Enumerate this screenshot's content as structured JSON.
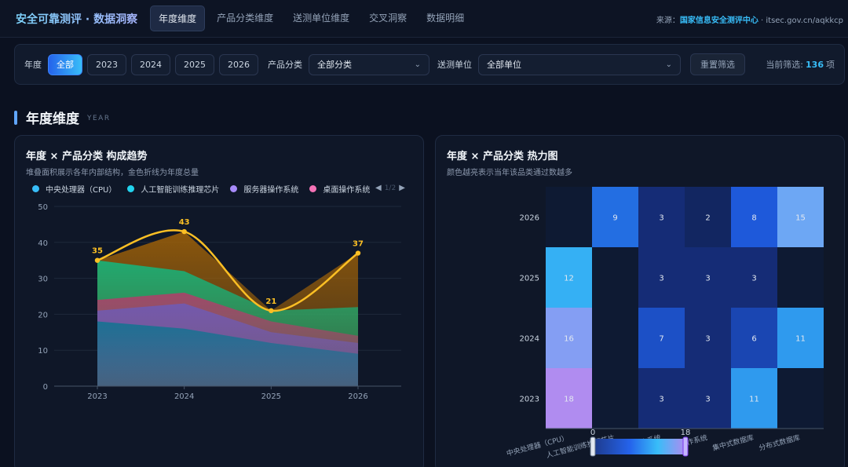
{
  "brand": "安全可靠测评 · 数据洞察",
  "nav": {
    "tabs": [
      "年度维度",
      "产品分类维度",
      "送测单位维度",
      "交叉洞察",
      "数据明细"
    ],
    "active": 0
  },
  "source": {
    "prefix": "来源：",
    "org": "国家信息安全测评中心",
    "suffix": " · itsec.gov.cn/aqkkcp"
  },
  "filters": {
    "year_label": "年度",
    "years": [
      "全部",
      "2023",
      "2024",
      "2025",
      "2026"
    ],
    "active_year": 0,
    "category_label": "产品分类",
    "category_value": "全部分类",
    "unit_label": "送测单位",
    "unit_value": "全部单位",
    "reset_label": "重置筛选",
    "count_prefix": "当前筛选:",
    "count_value": "136",
    "count_suffix": "项"
  },
  "section": {
    "title": "年度维度",
    "subtitle": "YEAR"
  },
  "cards": {
    "left": {
      "title": "年度 × 产品分类 构成趋势",
      "desc": "堆叠面积展示各年内部结构，金色折线为年度总量"
    },
    "right": {
      "title": "年度 × 产品分类 热力图",
      "desc": "颜色越亮表示当年该品类通过数越多"
    }
  },
  "legend": {
    "items": [
      {
        "label": "中央处理器（CPU）",
        "color": "#38bdf8"
      },
      {
        "label": "人工智能训练推理芯片",
        "color": "#22d3ee"
      },
      {
        "label": "服务器操作系统",
        "color": "#a78bfa"
      },
      {
        "label": "桌面操作系统",
        "color": "#f472b6"
      }
    ],
    "page": "1/2"
  },
  "colors": {
    "accent": "#38bdf8",
    "total_line": "#fbbf24"
  },
  "chart_data": [
    {
      "type": "area",
      "title": "年度 × 产品分类 构成趋势",
      "x": [
        "2023",
        "2024",
        "2025",
        "2026"
      ],
      "ylim": [
        0,
        50
      ],
      "yticks": [
        0,
        10,
        20,
        30,
        40,
        50
      ],
      "grid": true,
      "stack_layers": [
        {
          "values": [
            18,
            16,
            12,
            9
          ],
          "color": "#0e7490"
        },
        {
          "values": [
            21,
            23,
            15,
            12
          ],
          "color": "#6d5bb8"
        },
        {
          "values": [
            24,
            26,
            18,
            14
          ],
          "color": "#b43b6a"
        },
        {
          "values": [
            35,
            32,
            21,
            22
          ],
          "color": "#10b981"
        },
        {
          "values": [
            35,
            43,
            21,
            37
          ],
          "color": "#a16207"
        }
      ],
      "total": {
        "values": [
          35,
          43,
          21,
          37
        ],
        "labels": [
          "35",
          "43",
          "21",
          "37"
        ],
        "color": "#fbbf24"
      }
    },
    {
      "type": "heatmap",
      "title": "年度 × 产品分类 热力图",
      "y": [
        "2026",
        "2025",
        "2024",
        "2023"
      ],
      "x": [
        "中央处理器（CPU）",
        "人工智能训练推理芯片",
        "服务器操作系统",
        "桌面操作系统",
        "集中式数据库",
        "分布式数据库"
      ],
      "values": [
        [
          0,
          9,
          3,
          2,
          8,
          15
        ],
        [
          12,
          0,
          3,
          3,
          3,
          0
        ],
        [
          16,
          0,
          7,
          3,
          6,
          11
        ],
        [
          18,
          0,
          3,
          3,
          11,
          0
        ]
      ],
      "range": [
        0,
        18
      ],
      "range_labels": [
        "0",
        "18"
      ]
    }
  ]
}
